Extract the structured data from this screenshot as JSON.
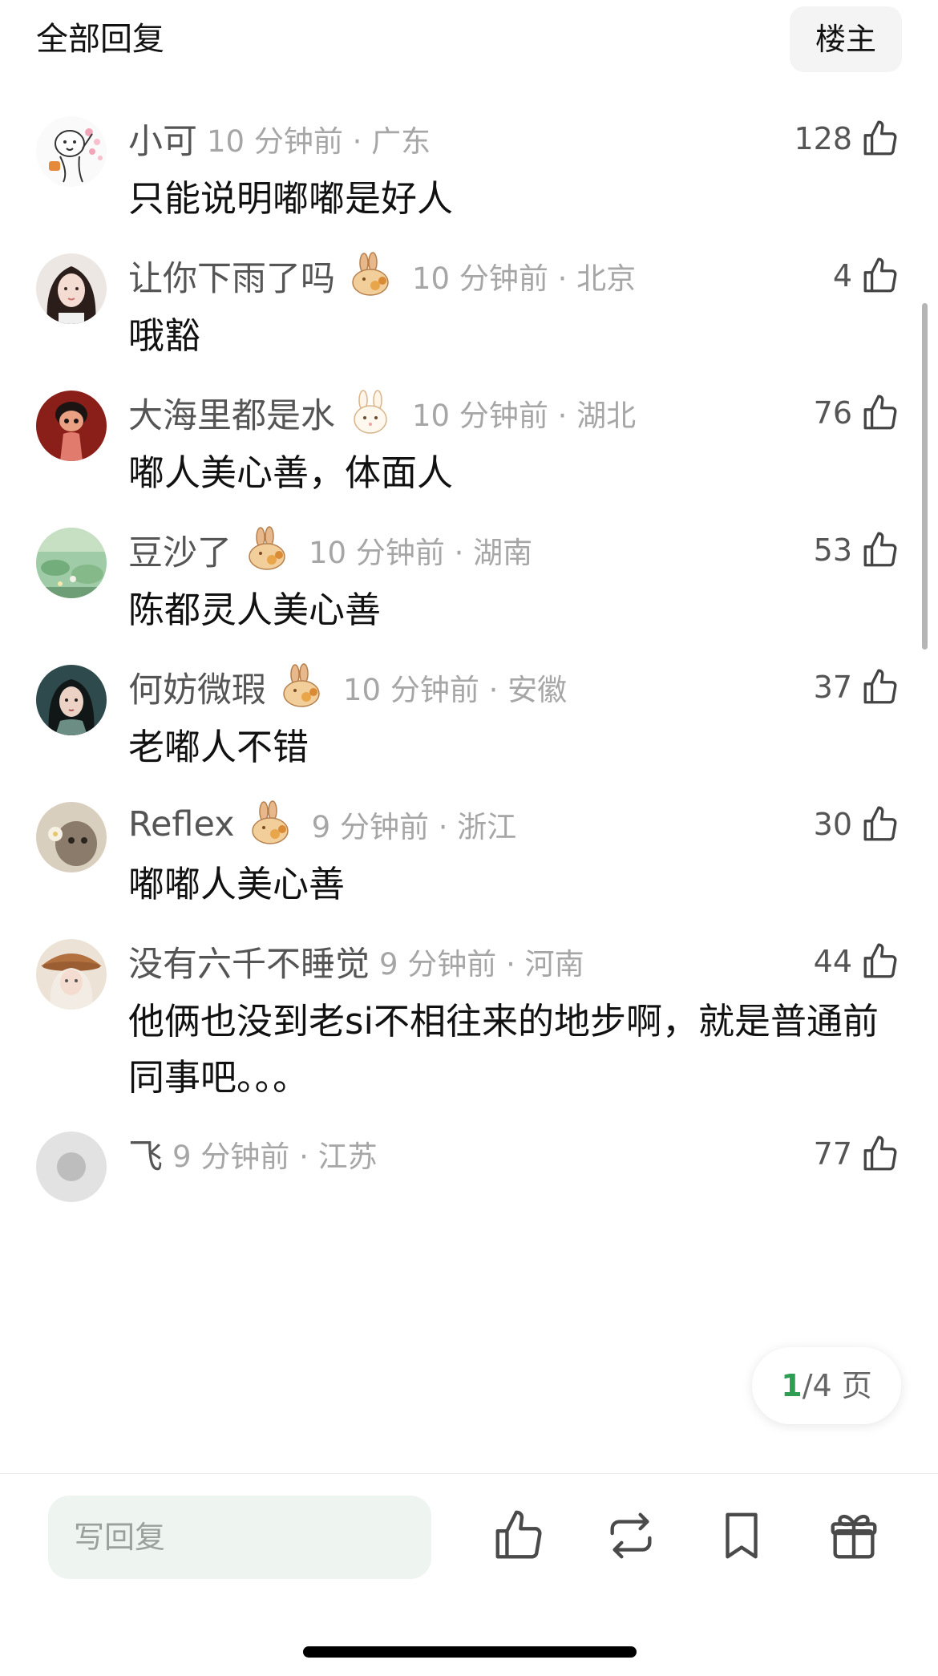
{
  "header": {
    "title": "全部回复",
    "owner_label": "楼主"
  },
  "comments": [
    {
      "name": "小可",
      "time": "10 分钟前 · 广东",
      "likes": "128",
      "text": "只能说明嘟嘟是好人"
    },
    {
      "name": "让你下雨了吗",
      "time": "10 分钟前 · 北京",
      "likes": "4",
      "text": "哦豁"
    },
    {
      "name": "大海里都是水",
      "time": "10 分钟前 · 湖北",
      "likes": "76",
      "text": "嘟人美心善，体面人"
    },
    {
      "name": "豆沙了",
      "time": "10 分钟前 · 湖南",
      "likes": "53",
      "text": "陈都灵人美心善"
    },
    {
      "name": "何妨微瑕",
      "time": "10 分钟前 · 安徽",
      "likes": "37",
      "text": "老嘟人不错"
    },
    {
      "name": "Reflex",
      "time": "9 分钟前 · 浙江",
      "likes": "30",
      "text": "嘟嘟人美心善"
    },
    {
      "name": "没有六千不睡觉",
      "time": "9 分钟前 · 河南",
      "likes": "44",
      "text": "他俩也没到老si不相往来的地步啊，就是普通前同事吧。。。"
    },
    {
      "name": "飞",
      "time": "9 分钟前 · 江苏",
      "likes": "77",
      "text": ""
    }
  ],
  "pager": {
    "current": "1",
    "total": "/4 页"
  },
  "reply_bar": {
    "placeholder": "写回复",
    "icons": [
      "thumb-up-icon",
      "repost-icon",
      "bookmark-icon",
      "gift-icon"
    ]
  },
  "colors": {
    "accent_green": "#2f9e55",
    "secondary_text": "#a6a6a6"
  }
}
